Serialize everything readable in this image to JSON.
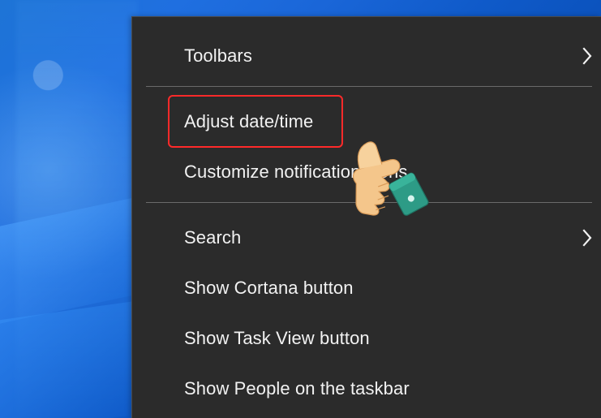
{
  "desktop": {
    "background_color": "#0a4fb8"
  },
  "menu": {
    "background_color": "#2b2b2b",
    "text_color": "#f2f2f2",
    "separator_color": "#6a6a6a",
    "highlight_color": "#ff2a2a",
    "items": [
      {
        "label": "Toolbars",
        "has_submenu": true
      },
      {
        "label": "Adjust date/time",
        "has_submenu": false,
        "highlighted": true
      },
      {
        "label": "Customize notification icons",
        "has_submenu": false
      },
      {
        "label": "Search",
        "has_submenu": true
      },
      {
        "label": "Show Cortana button",
        "has_submenu": false
      },
      {
        "label": "Show Task View button",
        "has_submenu": false
      },
      {
        "label": "Show People on the taskbar",
        "has_submenu": false
      }
    ]
  },
  "icons": {
    "submenu_arrow": "chevron-right-icon",
    "pointer": "pointing-hand-icon"
  }
}
